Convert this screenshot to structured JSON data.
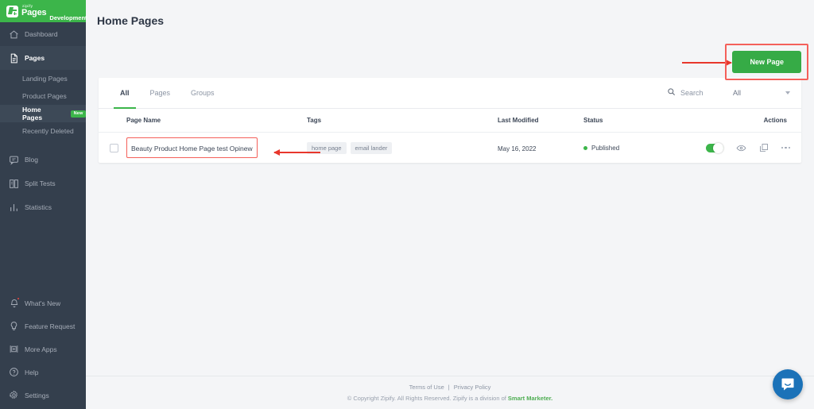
{
  "brand": {
    "zipify": "zipify",
    "product": "Pages",
    "environment": "Development",
    "logo_icon": "zipify-pages-logo-icon"
  },
  "sidebar": {
    "items": [
      {
        "label": "Dashboard",
        "icon": "home-icon"
      },
      {
        "label": "Pages",
        "icon": "document-icon"
      }
    ],
    "sub_items": [
      {
        "label": "Landing Pages",
        "badge": ""
      },
      {
        "label": "Product Pages",
        "badge": ""
      },
      {
        "label": "Home Pages",
        "badge": "New"
      },
      {
        "label": "Recently Deleted",
        "badge": ""
      }
    ],
    "mid_items": [
      {
        "label": "Blog",
        "icon": "chat-bubble-icon"
      },
      {
        "label": "Split Tests",
        "icon": "split-test-icon"
      },
      {
        "label": "Statistics",
        "icon": "bar-chart-icon"
      }
    ],
    "bottom_items": [
      {
        "label": "What's New",
        "icon": "bell-icon"
      },
      {
        "label": "Feature Request",
        "icon": "lightbulb-icon"
      },
      {
        "label": "More Apps",
        "icon": "apps-icon"
      },
      {
        "label": "Help",
        "icon": "question-circle-icon"
      },
      {
        "label": "Settings",
        "icon": "gear-icon"
      }
    ]
  },
  "header": {
    "title": "Home Pages"
  },
  "toolbar": {
    "new_page_label": "New Page"
  },
  "card": {
    "tabs": [
      {
        "label": "All",
        "active": true
      },
      {
        "label": "Pages",
        "active": false
      },
      {
        "label": "Groups",
        "active": false
      }
    ],
    "search": {
      "placeholder": "Search",
      "value": "",
      "icon": "search-icon"
    },
    "filter": {
      "selected": "All",
      "icon": "chevron-down-icon"
    },
    "columns": [
      "Page Name",
      "Tags",
      "Last Modified",
      "Status",
      "Actions"
    ],
    "rows": [
      {
        "checked": false,
        "page_name": "Beauty Product Home Page test Opinew",
        "tags": [
          "home page",
          "email lander"
        ],
        "last_modified": "May 16, 2022",
        "status": "Published",
        "status_color": "#3cb54a",
        "toggle_on": true,
        "actions": [
          "preview-eye-icon",
          "duplicate-icon",
          "more-options-icon"
        ]
      }
    ]
  },
  "footer": {
    "terms": "Terms of Use",
    "separator": "|",
    "privacy": "Privacy Policy",
    "copyright_prefix": "© Copyright Zipify. All Rights Reserved. Zipify is a division of ",
    "copyright_link": "Smart Marketer."
  },
  "chat": {
    "icon": "intercom-chat-icon"
  },
  "annotations": {
    "accent_red": "#e8372c",
    "brand_green": "#3cb54a"
  }
}
